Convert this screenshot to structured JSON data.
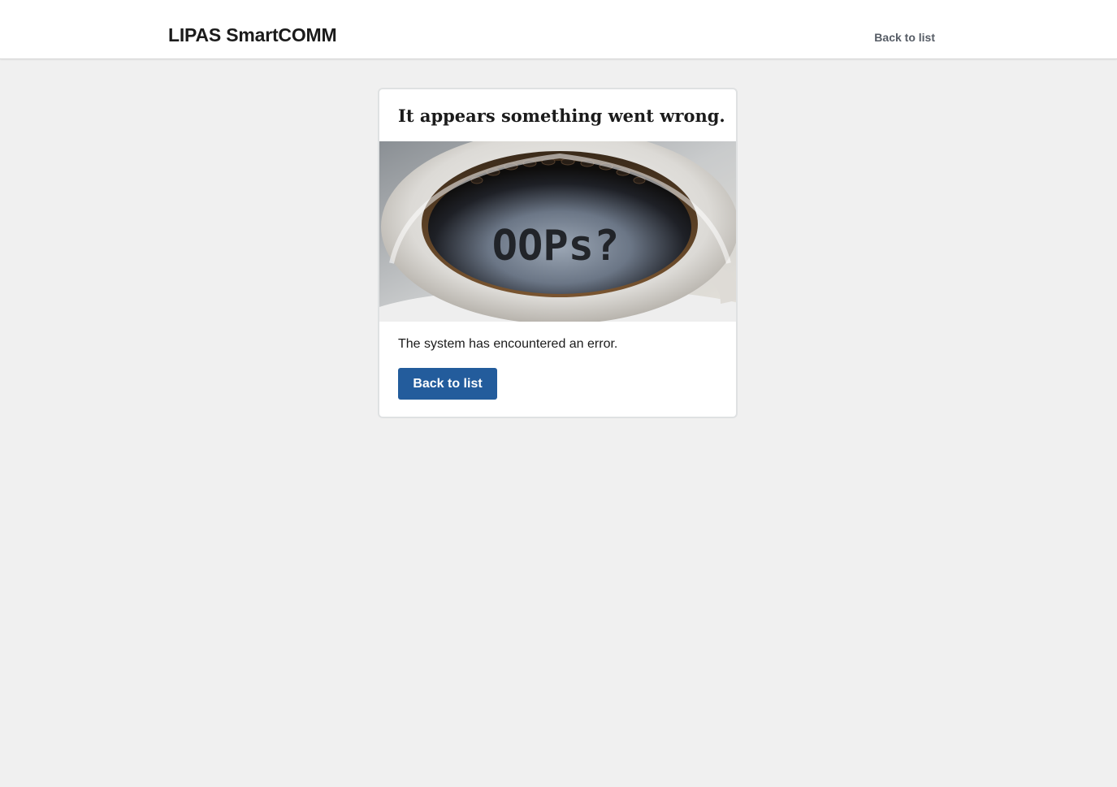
{
  "header": {
    "brand": "LIPAS SmartCOMM",
    "nav_link": "Back to list"
  },
  "card": {
    "title": "It appears something went wrong.",
    "image_text": "OOPs?",
    "message": "The system has encountered an error.",
    "button_label": "Back to list"
  },
  "colors": {
    "background": "#f0f0f0",
    "header_bg": "#ffffff",
    "primary_button": "#235c9c",
    "nav_link": "#565c65"
  },
  "icons": {
    "error_image": "coffee-cup-oops-image"
  }
}
